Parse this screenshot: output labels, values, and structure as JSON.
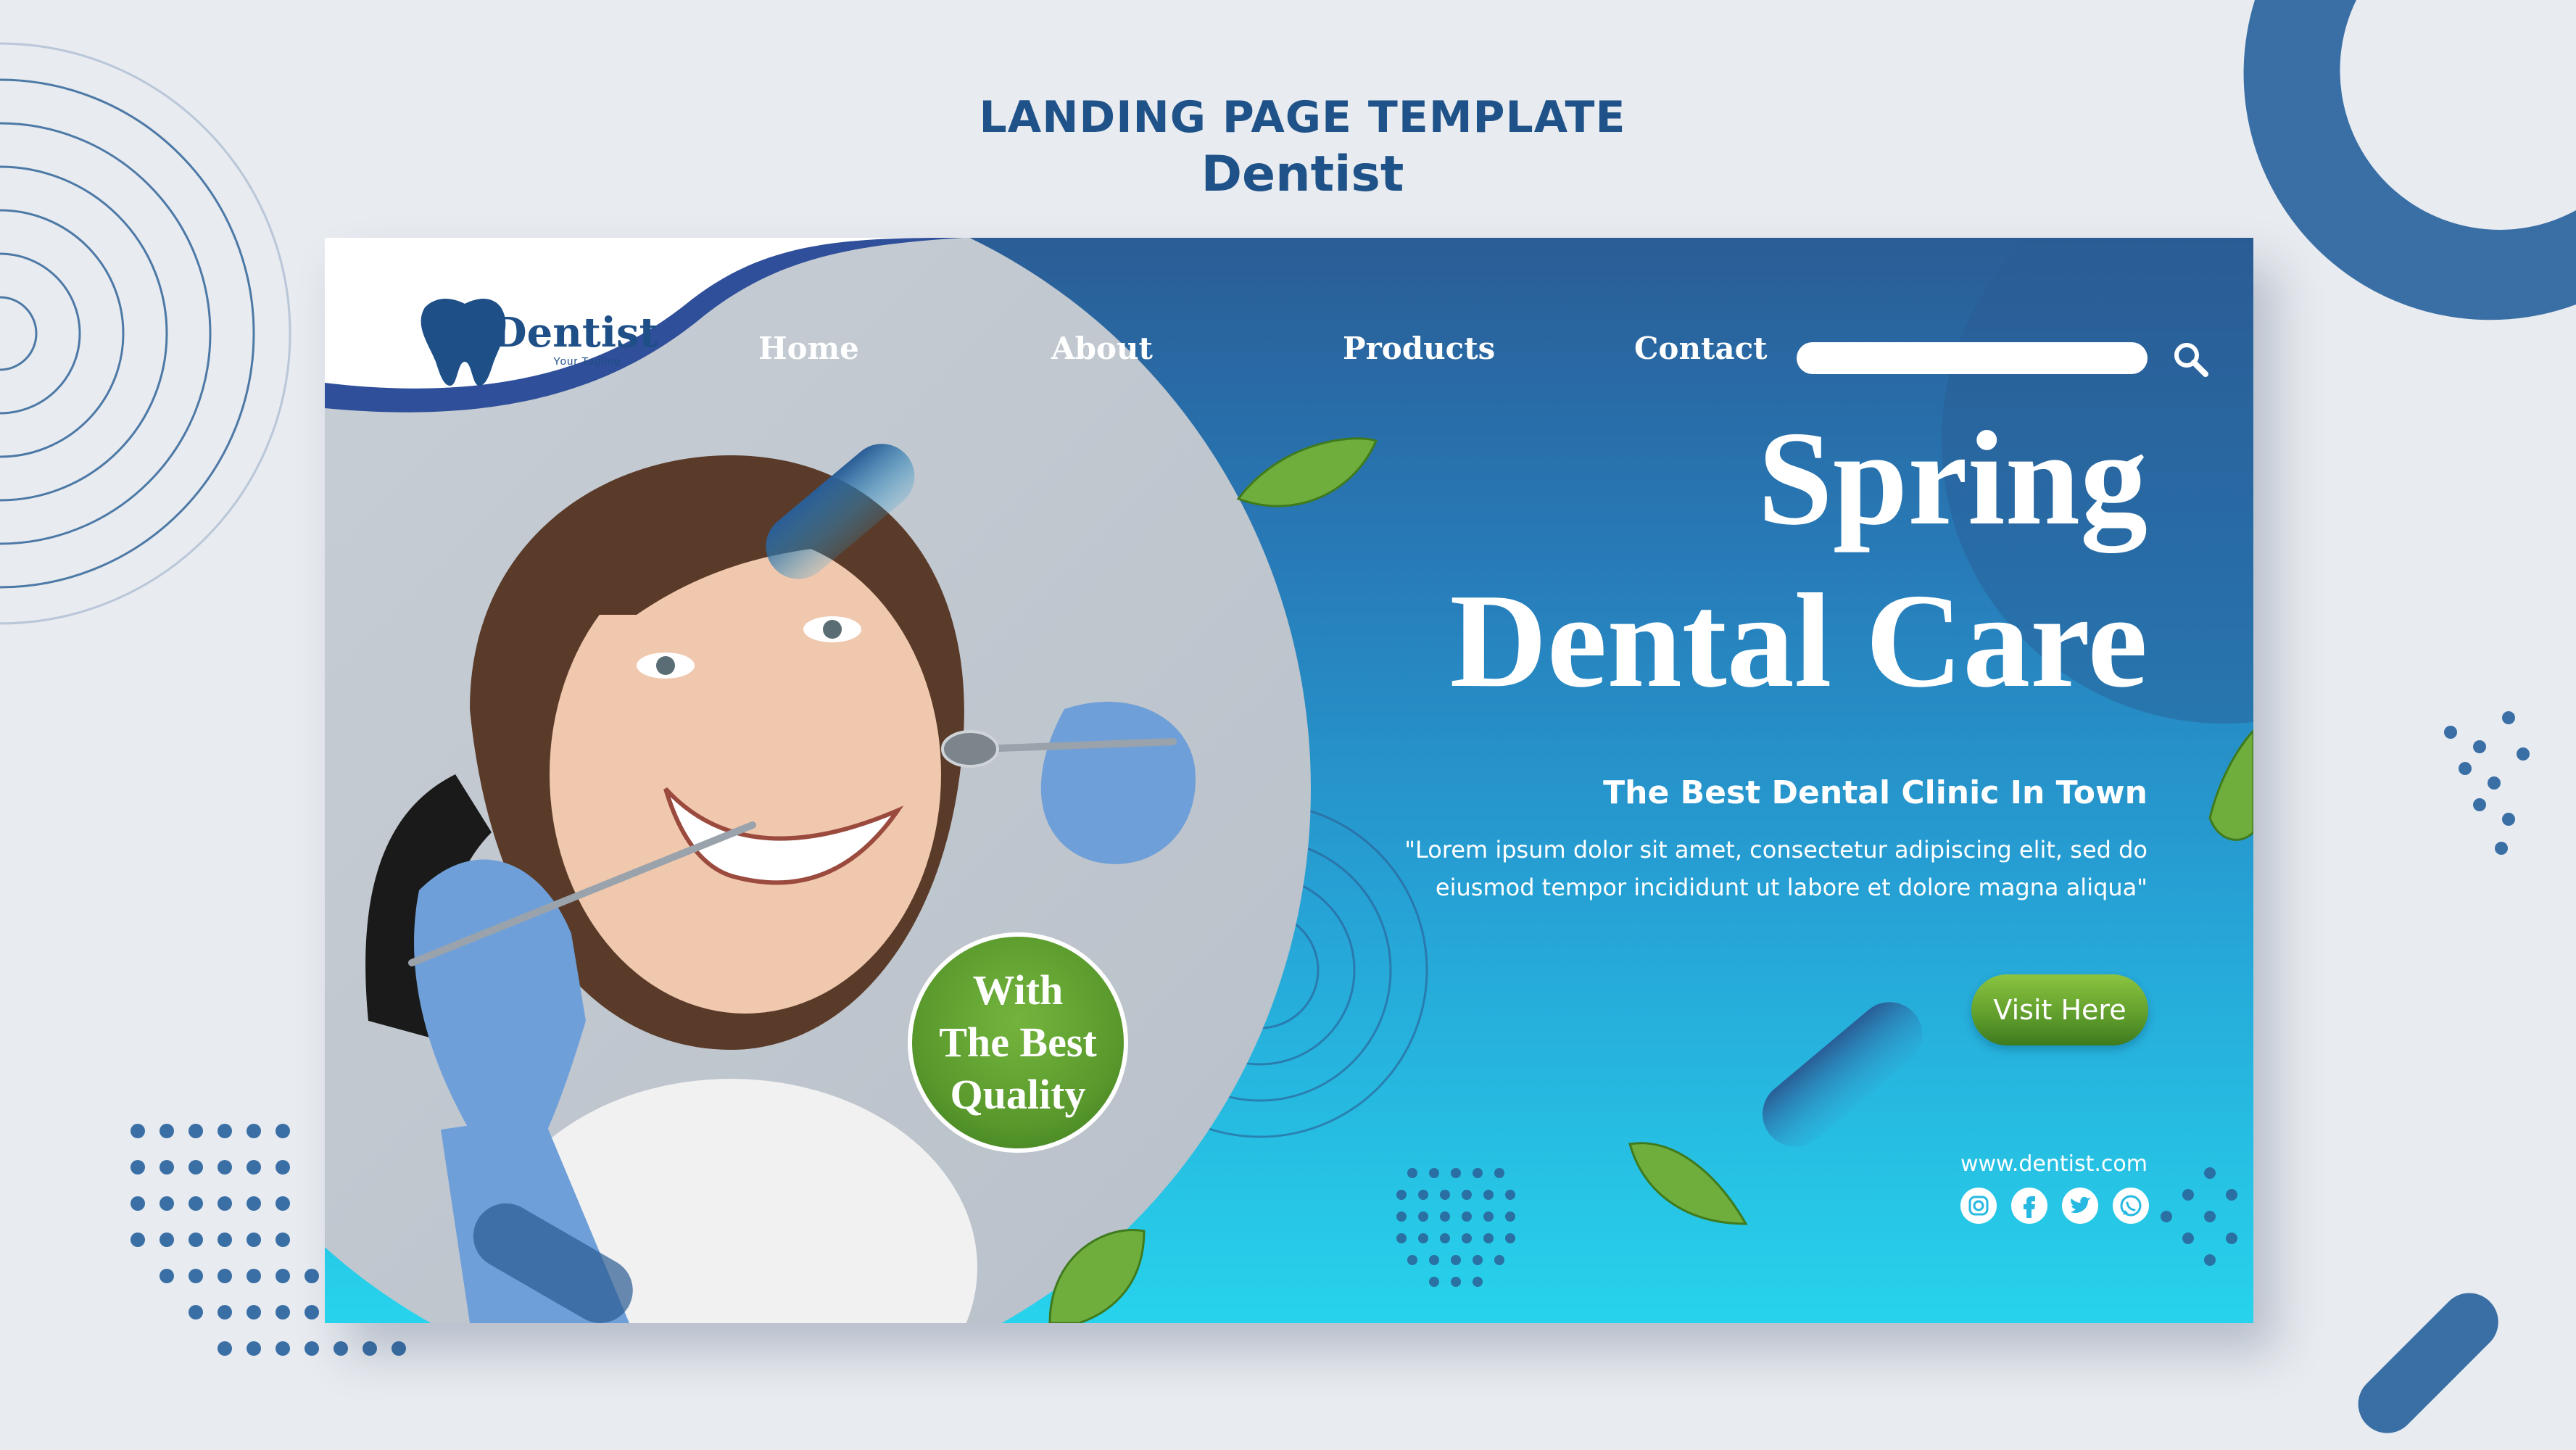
{
  "page_header": {
    "title": "LANDING PAGE TEMPLATE",
    "subtitle": "Dentist"
  },
  "banner": {
    "logo": {
      "name": "Dentist",
      "tagline": "Your Tagline",
      "icon": "tooth-icon"
    },
    "nav": [
      {
        "label": "Home"
      },
      {
        "label": "About"
      },
      {
        "label": "Products"
      },
      {
        "label": "Contact"
      }
    ],
    "search": {
      "placeholder": "",
      "value": "",
      "icon": "search-icon"
    },
    "headline_line1": "Spring",
    "headline_line2": "Dental Care",
    "subheadline": "The Best Dental Clinic In Town",
    "quote": "\"Lorem ipsum dolor sit amet, consectetur adipiscing elit, sed do eiusmod tempor incididunt ut labore et dolore magna aliqua\"",
    "cta_label": "Visit Here",
    "badge_text": "With\nThe Best\nQuality",
    "website": "www.dentist.com",
    "social_icons": [
      "instagram-icon",
      "facebook-icon",
      "twitter-icon",
      "whatsapp-icon"
    ],
    "photo": "smiling woman at dentist examination"
  },
  "colors": {
    "brand_dark": "#1f4f87",
    "gradient_top": "#2a5d96",
    "gradient_bottom": "#27d3ec",
    "cta_green": "#5e9c2c",
    "page_bg": "#e8ebf0"
  }
}
